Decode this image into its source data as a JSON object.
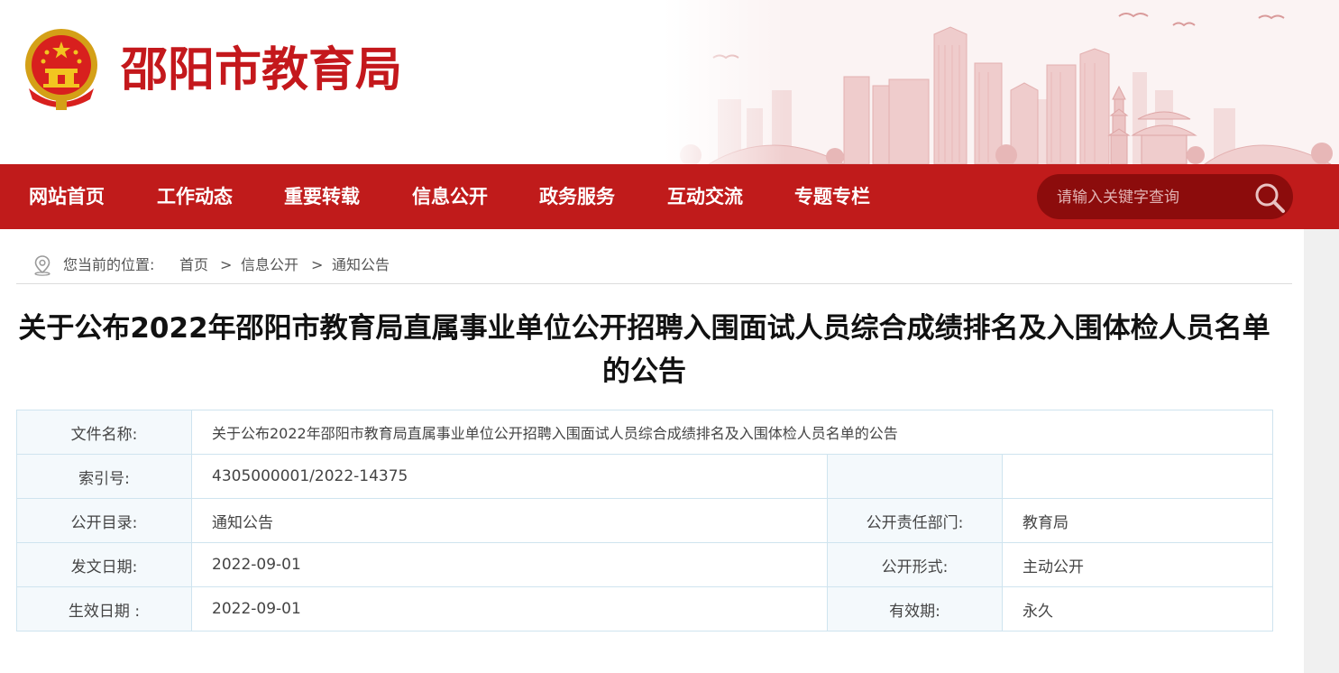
{
  "header": {
    "site_title": "邵阳市教育局",
    "emblem": "national-emblem-icon",
    "banner": "city-skyline-illustration"
  },
  "nav": {
    "items": [
      "网站首页",
      "工作动态",
      "重要转载",
      "信息公开",
      "政务服务",
      "互动交流",
      "专题专栏"
    ],
    "search_placeholder": "请输入关键字查询"
  },
  "breadcrumb": {
    "label": "您当前的位置:",
    "items": [
      "首页",
      "信息公开",
      "通知公告"
    ],
    "separator": ">"
  },
  "article": {
    "title_line1": "关于公布2022年邵阳市教育局直属事业单位公开招聘入围面试人员综合成绩排名及入围体检人员名单",
    "title_line2": "的公告"
  },
  "meta": {
    "file_name_label": "文件名称:",
    "file_name": "关于公布2022年邵阳市教育局直属事业单位公开招聘入围面试人员综合成绩排名及入围体检人员名单的公告",
    "index_label": "索引号:",
    "index_value": "4305000001/2022-14375",
    "catalog_label": "公开目录:",
    "catalog_value": "通知公告",
    "dept_label": "公开责任部门:",
    "dept_value": "教育局",
    "issue_date_label": "发文日期:",
    "issue_date_value": "2022-09-01",
    "form_label": "公开形式:",
    "form_value": "主动公开",
    "effective_label": "生效日期 :",
    "effective_value": "2022-09-01",
    "validity_label": "有效期:",
    "validity_value": "永久"
  },
  "colors": {
    "brand_red": "#c01b1b",
    "title_red": "#c4181c",
    "search_bg": "#8c0c0c",
    "table_border": "#cfe4ef"
  }
}
